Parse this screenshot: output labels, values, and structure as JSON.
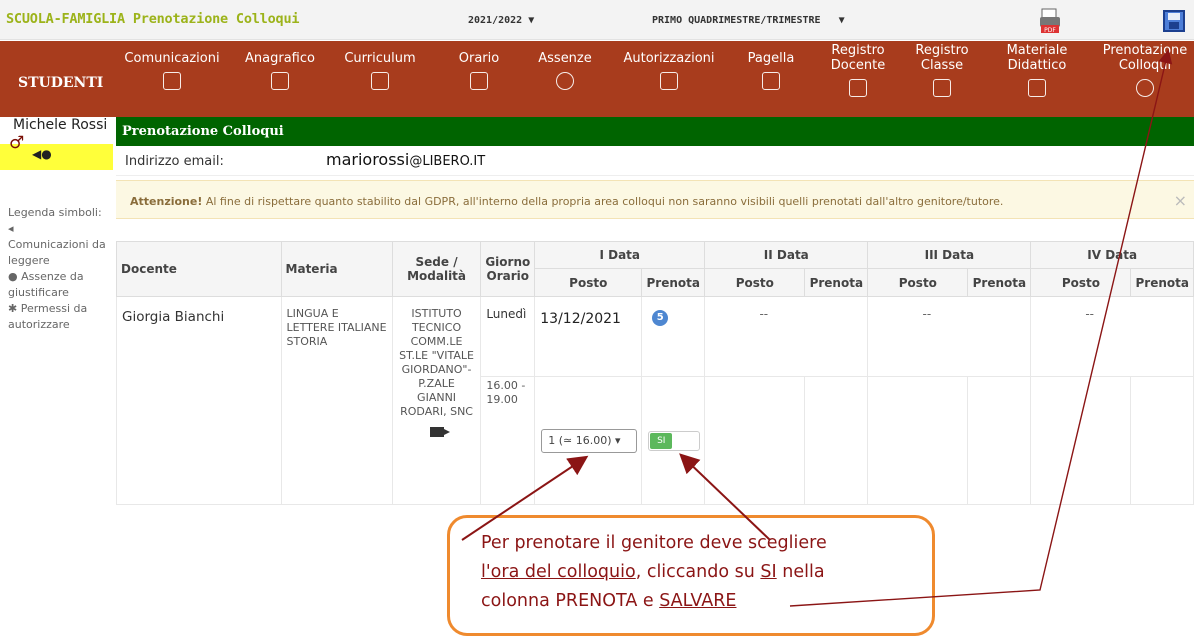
{
  "topbar": {
    "app_title": "SCUOLA-FAMIGLIA Prenotazione Colloqui",
    "year": "2021/2022",
    "period": "PRIMO QUADRIMESTRE/TRIMESTRE"
  },
  "nav": {
    "section": "STUDENTI",
    "items": [
      {
        "label": "Comunicazioni",
        "icon": "pen-icon"
      },
      {
        "label": "Anagrafico",
        "icon": "form-icon"
      },
      {
        "label": "Curriculum",
        "icon": "document-icon"
      },
      {
        "label": "Orario",
        "icon": "calendar-icon"
      },
      {
        "label": "Assenze",
        "icon": "smiley-icon"
      },
      {
        "label": "Autorizzazioni",
        "icon": "approval-icon"
      },
      {
        "label": "Pagella",
        "icon": "report-icon"
      },
      {
        "label": "Registro Docente",
        "icon": "book-icon"
      },
      {
        "label": "Registro Classe",
        "icon": "book-icon"
      },
      {
        "label": "Materiale Didattico",
        "icon": "puzzle-icon"
      },
      {
        "label": "Prenotazione Colloqui",
        "icon": "meeting-icon"
      }
    ]
  },
  "user": {
    "name": "Michele Rossi",
    "icons": "◀●"
  },
  "legend": {
    "title": "Legenda simboli:",
    "items": [
      "Comunicazioni da leggere",
      "Assenze da giustificare",
      "Permessi da autorizzare"
    ]
  },
  "panel": {
    "title": "Prenotazione Colloqui",
    "email_label": "Indirizzo email:",
    "email_user": "mariorossi",
    "email_domain": "@LIBERO.IT",
    "warning_bold": "Attenzione!",
    "warning_text": "Al fine di rispettare quanto stabilito dal GDPR, all'interno della propria area colloqui non saranno visibili quelli prenotati dall'altro genitore/tutore.",
    "close": "×"
  },
  "table": {
    "headers": {
      "docente": "Docente",
      "materia": "Materia",
      "sede": "Sede / Modalità",
      "giorno": "Giorno Orario",
      "data1": "I Data",
      "data2": "II Data",
      "data3": "III Data",
      "data4": "IV Data",
      "posto": "Posto",
      "prenota": "Prenota"
    },
    "row": {
      "docente": "Giorgia Bianchi",
      "materia": "LINGUA E LETTERE ITALIANE STORIA",
      "sede": "ISTITUTO TECNICO COMM.LE ST.LE \"VITALE GIORDANO\"- P.ZALE GIANNI RODARI, SNC",
      "giorno": "Lunedì",
      "orario": "16.00 - 19.00",
      "date1": "13/12/2021",
      "badge": "5",
      "empty": "--",
      "slot_selected": "1 (≃ 16.00)",
      "toggle_label": "SI"
    }
  },
  "callout": {
    "line1": "Per prenotare il genitore deve scegliere",
    "line2a": "l'ora del colloquio",
    "line2b": ", cliccando su ",
    "line2c": "SI",
    "line2d": " nella",
    "line3a": "colonna PRENOTA e ",
    "line3b": "SALVARE"
  }
}
